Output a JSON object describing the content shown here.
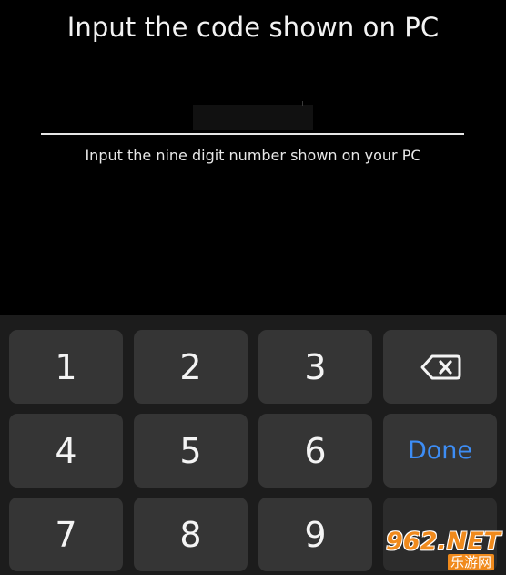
{
  "header": {
    "title": "Input the code shown on PC"
  },
  "code_input": {
    "hint": "Input the nine digit number shown on your PC"
  },
  "keypad": {
    "keys": [
      "1",
      "2",
      "3",
      "4",
      "5",
      "6",
      "7",
      "8",
      "9"
    ],
    "done_label": "Done",
    "backspace_icon": "backspace-icon",
    "done_color": "#3d8df5"
  },
  "watermark": {
    "logo_text": "962.NET",
    "sub_text": "乐游网"
  }
}
